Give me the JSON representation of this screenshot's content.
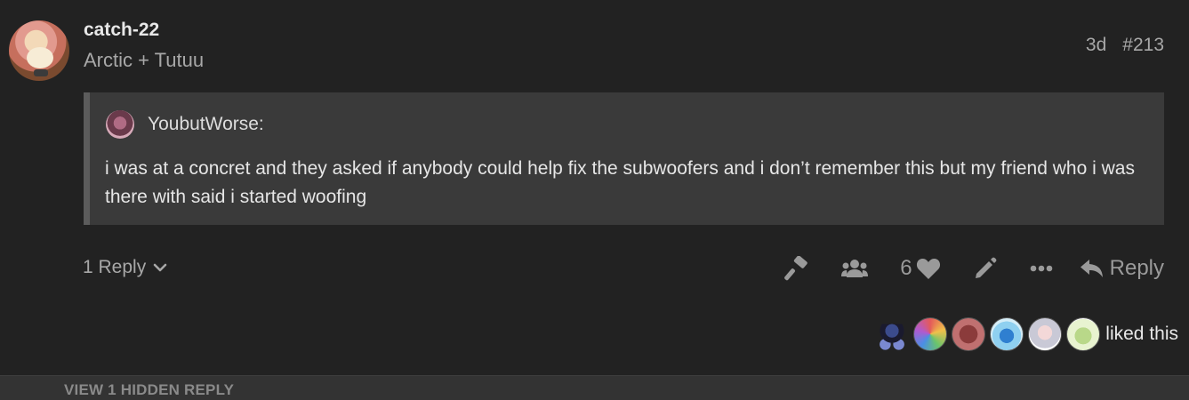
{
  "post": {
    "username": "catch-22",
    "user_title": "Arctic + Tutuu",
    "age": "3d",
    "post_number": "#213",
    "avatar_icon": "user-avatar-icon"
  },
  "quote": {
    "author": "YoubutWorse:",
    "text": "i was at a concret and they asked if anybody could help fix the subwoofers and i don’t remember this but my friend who i was there with said i started woofing"
  },
  "replies": {
    "label": "1 Reply"
  },
  "actions": {
    "like_count": "6",
    "reply_label": "Reply"
  },
  "likers": {
    "label": "liked this",
    "avatars": [
      "pixel-avatar",
      "rainbow-avatar",
      "dog-avatar",
      "blue-fish-avatar",
      "white-hair-avatar",
      "green-frog-avatar"
    ]
  },
  "hidden": {
    "label": "VIEW 1 HIDDEN REPLY"
  },
  "colors": {
    "background": "#222222",
    "quote_bg": "#3a3a3a",
    "muted": "#a8a8a8"
  }
}
